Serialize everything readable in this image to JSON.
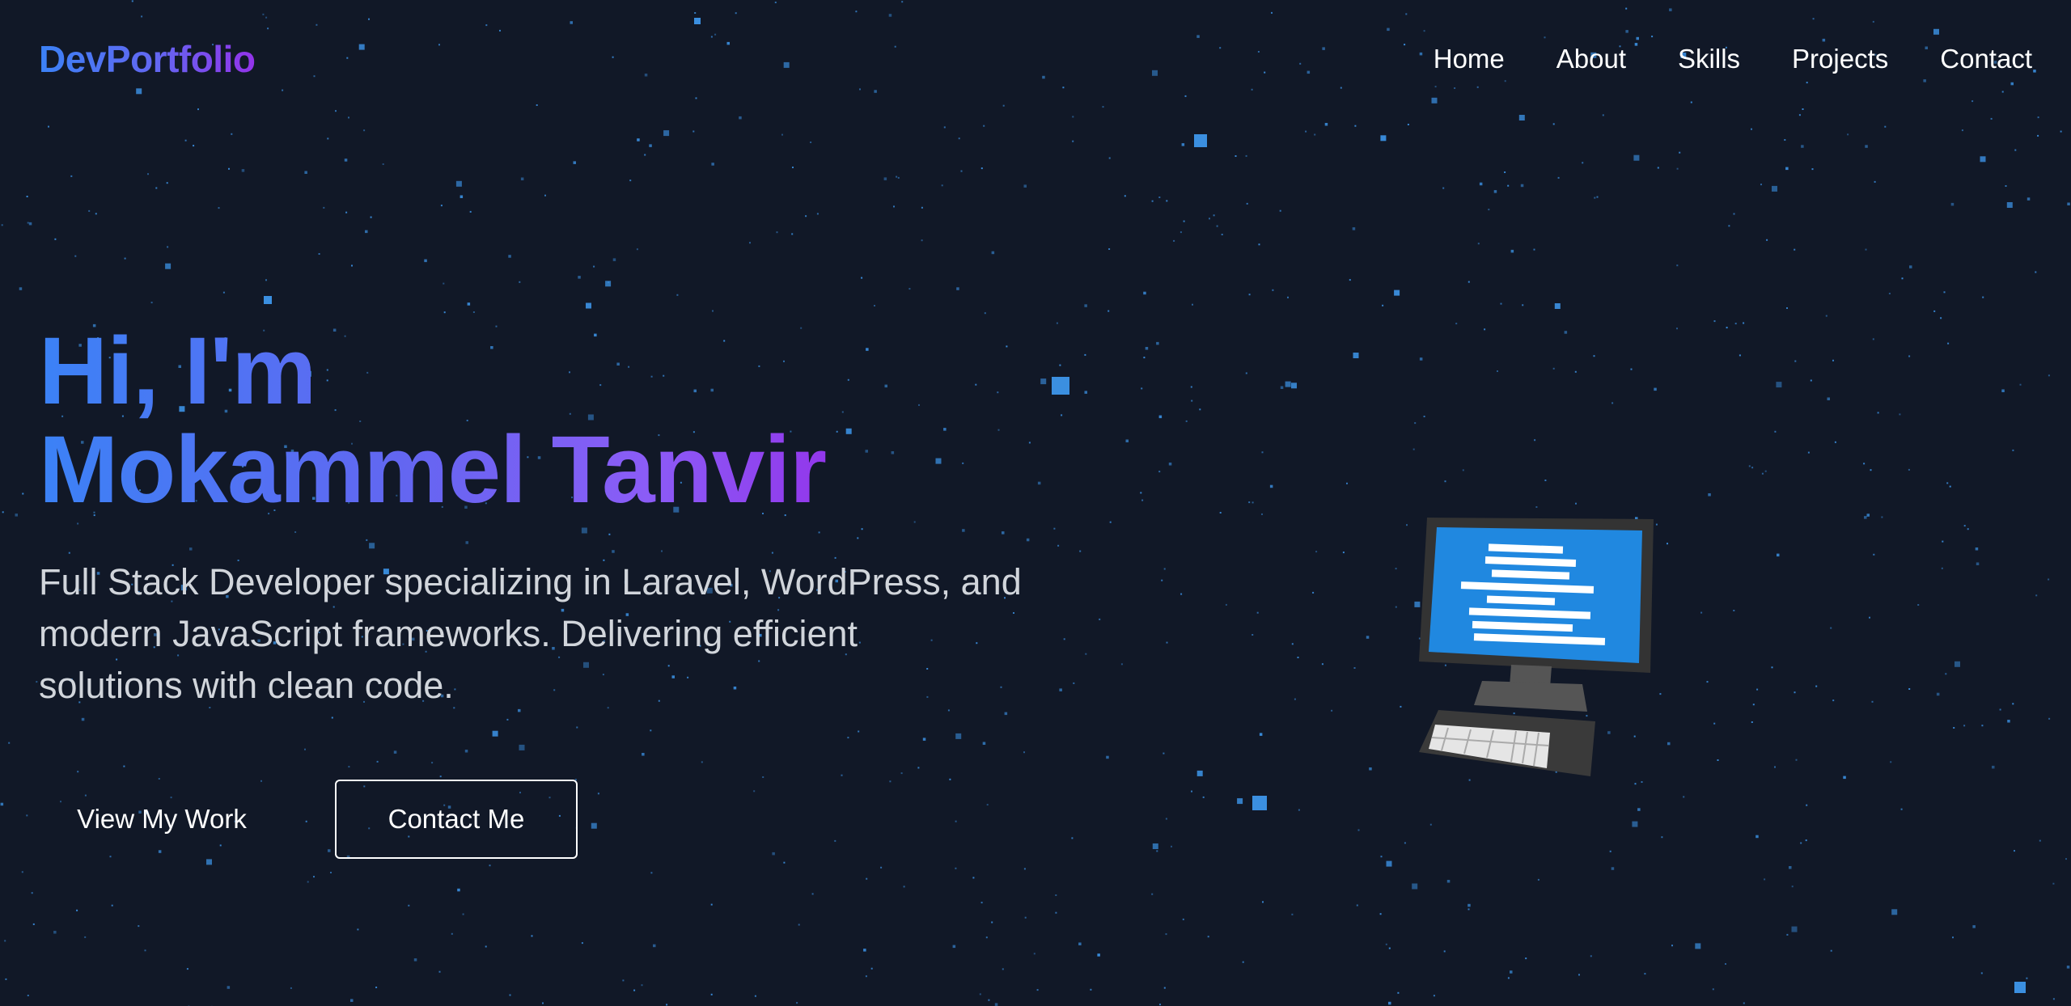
{
  "nav": {
    "logo": "DevPortfolio",
    "links": [
      "Home",
      "About",
      "Skills",
      "Projects",
      "Contact"
    ]
  },
  "hero": {
    "title_line1": "Hi, I'm",
    "title_line2": "Mokammel Tanvir",
    "description_lines": [
      "Full Stack Developer specializing in Laravel, WordPress, and",
      "modern JavaScript frameworks. Delivering efficient",
      "solutions with clean code."
    ],
    "primary_button": "View My Work",
    "secondary_button": "Contact Me"
  },
  "illustration": {
    "icon": "desktop-computer-icon"
  },
  "colors": {
    "background": "#111827",
    "gradient_start": "#3b82f6",
    "gradient_end": "#9333ea",
    "star": "#3b8fe0",
    "text_muted": "#d1d5db"
  }
}
